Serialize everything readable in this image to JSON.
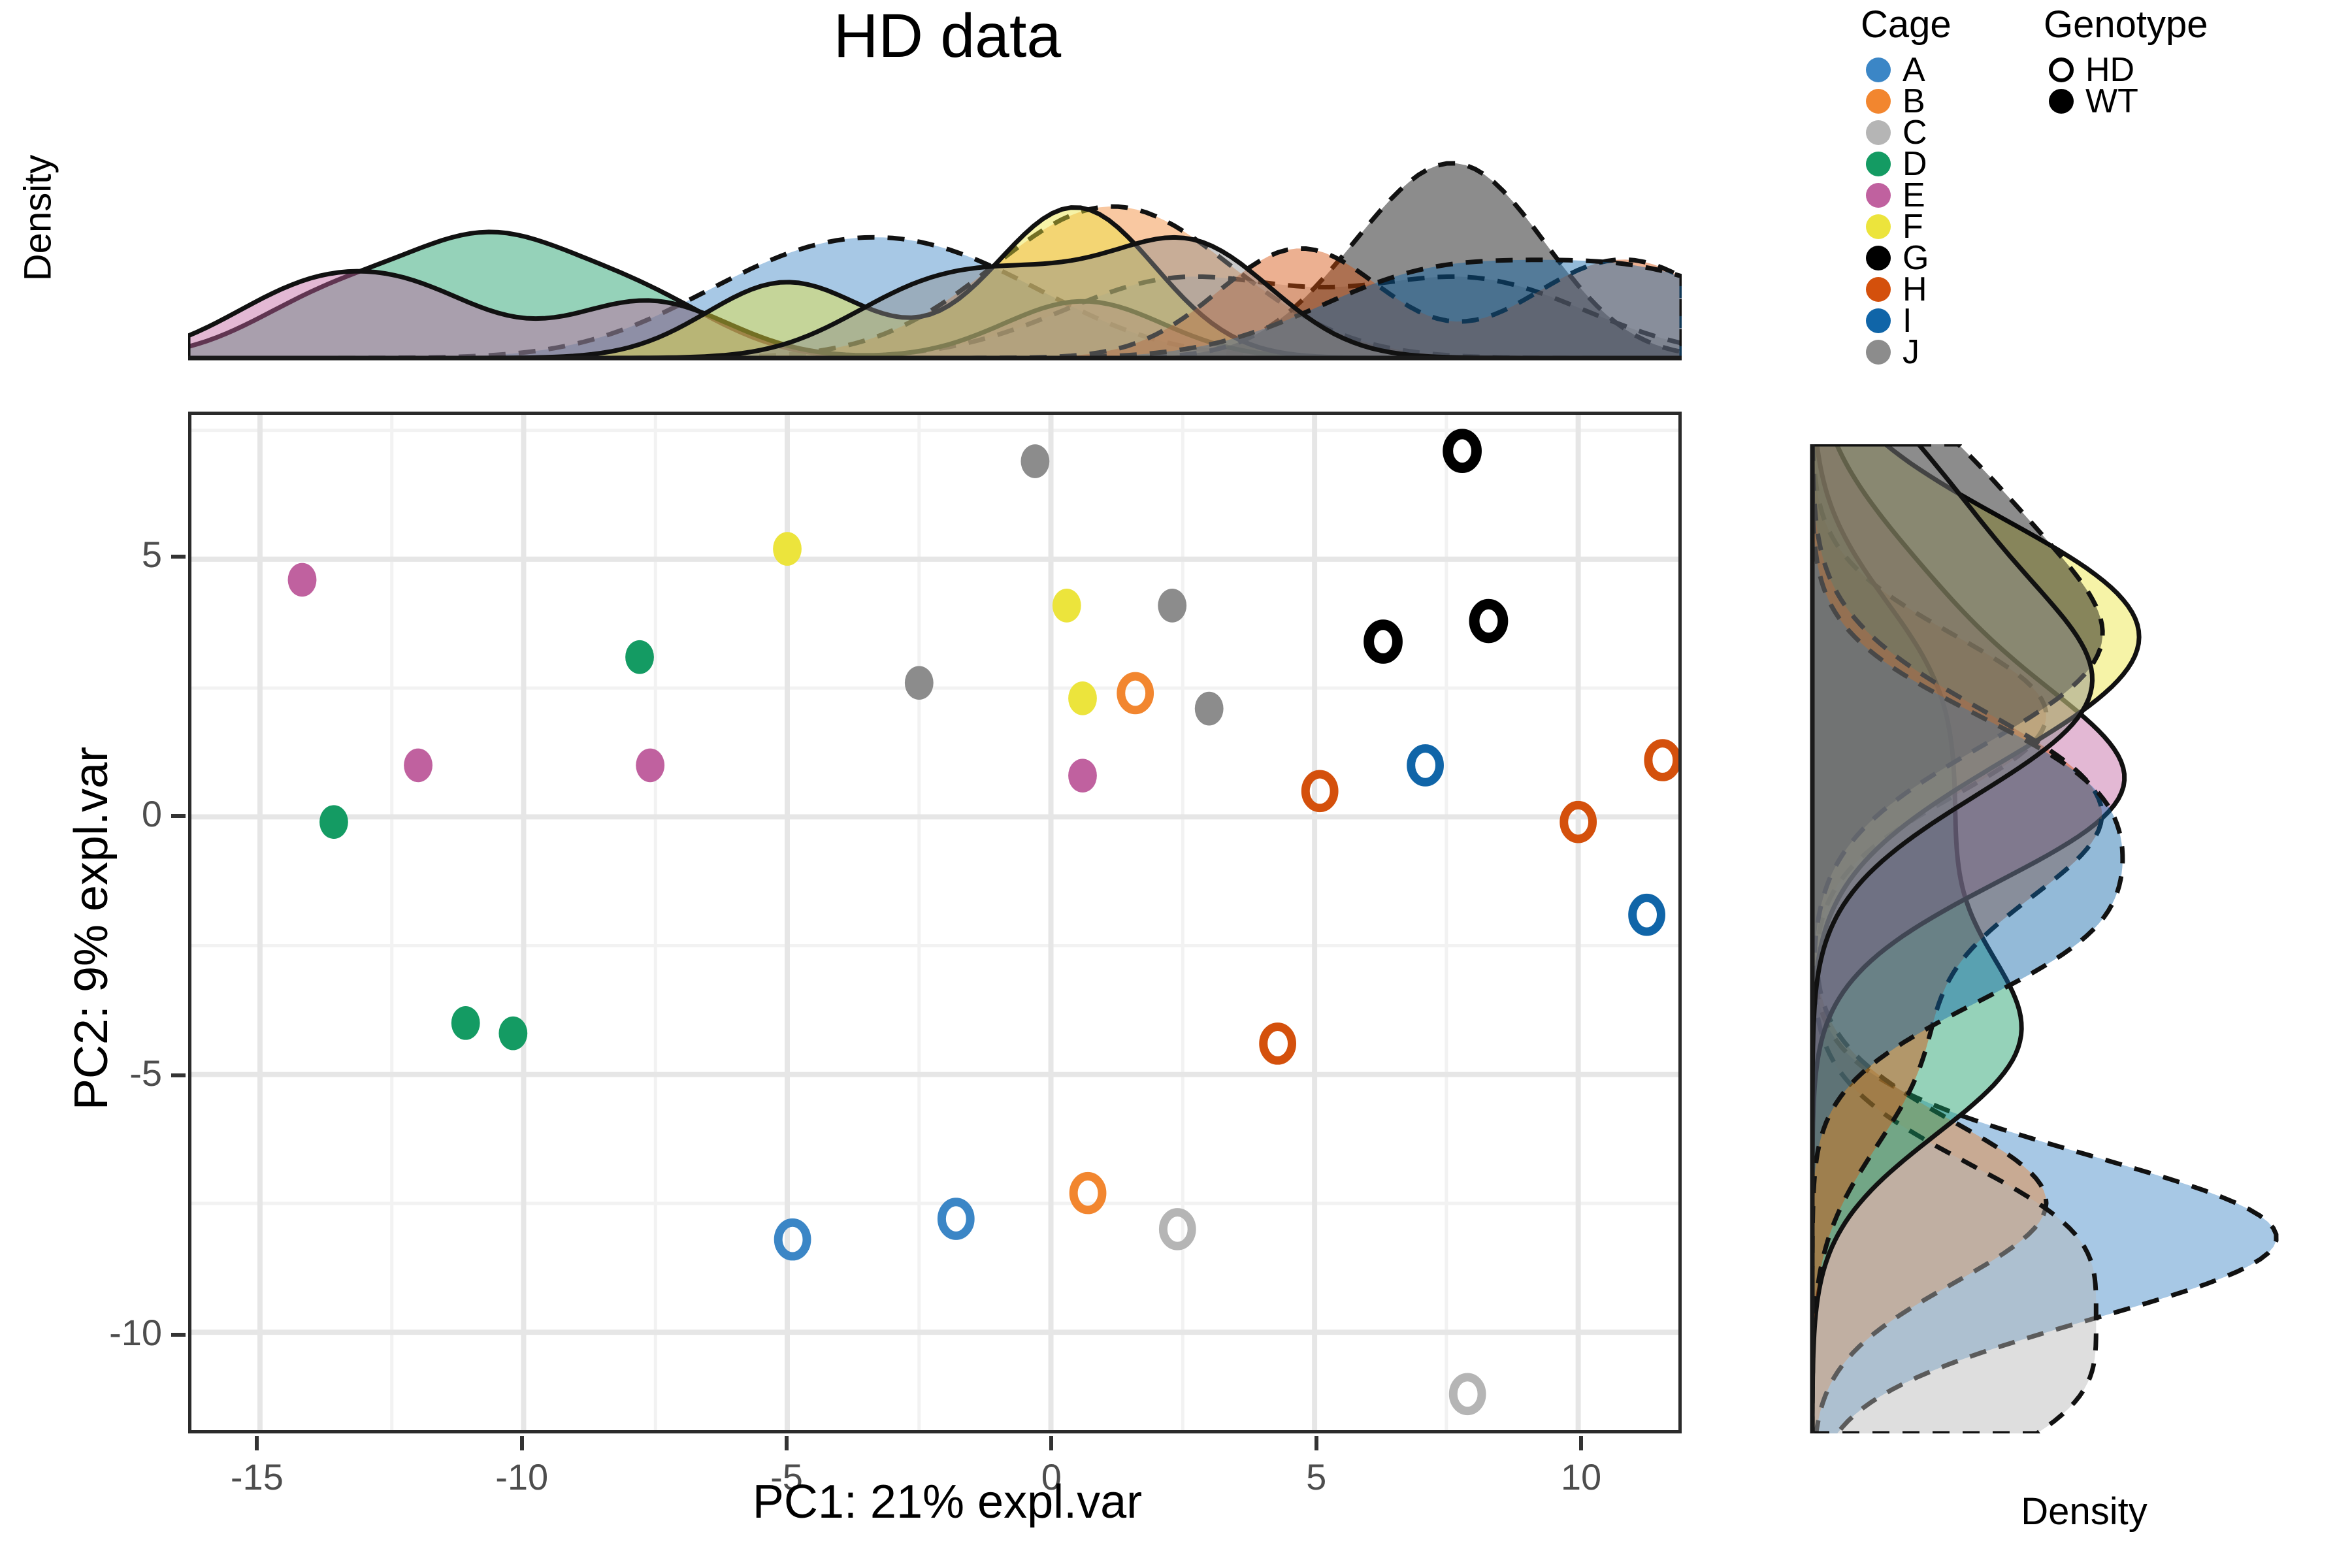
{
  "title": "HD data",
  "axes": {
    "x_title": "PC1: 21% expl.var",
    "y_title": "PC2: 9% expl.var",
    "x_ticks": [
      "-15",
      "-10",
      "-5",
      "0",
      "5",
      "10"
    ],
    "y_ticks": [
      "5",
      "0",
      "-5",
      "-10"
    ],
    "density_axis_label_top": "Density",
    "density_axis_label_right": "Density"
  },
  "legend_cage": {
    "title": "Cage",
    "items": [
      {
        "label": "A",
        "color": "#3b86c6"
      },
      {
        "label": "B",
        "color": "#f2862f"
      },
      {
        "label": "C",
        "color": "#b5b5b5"
      },
      {
        "label": "D",
        "color": "#149b63"
      },
      {
        "label": "E",
        "color": "#c0619f"
      },
      {
        "label": "F",
        "color": "#ece43c"
      },
      {
        "label": "G",
        "color": "#000000"
      },
      {
        "label": "H",
        "color": "#d4500c"
      },
      {
        "label": "I",
        "color": "#1065a8"
      },
      {
        "label": "J",
        "color": "#8c8c8c"
      }
    ]
  },
  "legend_genotype": {
    "title": "Genotype",
    "items": [
      {
        "label": "HD",
        "shape": "open-circle"
      },
      {
        "label": "WT",
        "shape": "filled-circle"
      }
    ]
  },
  "chart_data": {
    "type": "scatter",
    "title": "HD data",
    "xlabel": "PC1: 21% expl.var",
    "ylabel": "PC2: 9% expl.var",
    "xlim": [
      -16.3,
      11.9
    ],
    "ylim": [
      -11.9,
      7.8
    ],
    "xticks": [
      -15,
      -10,
      -5,
      0,
      5,
      10
    ],
    "yticks": [
      5,
      0,
      -5,
      -10
    ],
    "grid": true,
    "legend_position": "right",
    "groups": {
      "color_by": "Cage",
      "shape_by": "Genotype"
    },
    "points": [
      {
        "x": -14.2,
        "y": 4.6,
        "cage": "E",
        "genotype": "WT"
      },
      {
        "x": -13.6,
        "y": -0.1,
        "cage": "D",
        "genotype": "WT"
      },
      {
        "x": -12.0,
        "y": 1.0,
        "cage": "E",
        "genotype": "WT"
      },
      {
        "x": -11.1,
        "y": -4.0,
        "cage": "D",
        "genotype": "WT"
      },
      {
        "x": -10.2,
        "y": -4.2,
        "cage": "D",
        "genotype": "WT"
      },
      {
        "x": -7.8,
        "y": 3.1,
        "cage": "D",
        "genotype": "WT"
      },
      {
        "x": -7.6,
        "y": 1.0,
        "cage": "E",
        "genotype": "WT"
      },
      {
        "x": -5.0,
        "y": 5.2,
        "cage": "F",
        "genotype": "WT"
      },
      {
        "x": -4.9,
        "y": -8.2,
        "cage": "A",
        "genotype": "HD"
      },
      {
        "x": -2.5,
        "y": 2.6,
        "cage": "J",
        "genotype": "WT"
      },
      {
        "x": -1.8,
        "y": -7.8,
        "cage": "A",
        "genotype": "HD"
      },
      {
        "x": -0.3,
        "y": 6.9,
        "cage": "J",
        "genotype": "WT"
      },
      {
        "x": 0.3,
        "y": 4.1,
        "cage": "F",
        "genotype": "WT"
      },
      {
        "x": 0.6,
        "y": 2.3,
        "cage": "F",
        "genotype": "WT"
      },
      {
        "x": 0.6,
        "y": 0.8,
        "cage": "E",
        "genotype": "WT"
      },
      {
        "x": 0.7,
        "y": -7.3,
        "cage": "B",
        "genotype": "HD"
      },
      {
        "x": 1.6,
        "y": 2.4,
        "cage": "B",
        "genotype": "HD"
      },
      {
        "x": 2.3,
        "y": 4.1,
        "cage": "J",
        "genotype": "WT"
      },
      {
        "x": 2.4,
        "y": -8.0,
        "cage": "C",
        "genotype": "HD"
      },
      {
        "x": 3.0,
        "y": 2.1,
        "cage": "J",
        "genotype": "WT"
      },
      {
        "x": 4.3,
        "y": -4.4,
        "cage": "H",
        "genotype": "HD"
      },
      {
        "x": 5.1,
        "y": 0.5,
        "cage": "H",
        "genotype": "HD"
      },
      {
        "x": 6.3,
        "y": 3.4,
        "cage": "G",
        "genotype": "HD"
      },
      {
        "x": 7.1,
        "y": 1.0,
        "cage": "I",
        "genotype": "HD"
      },
      {
        "x": 7.8,
        "y": 7.1,
        "cage": "G",
        "genotype": "HD"
      },
      {
        "x": 7.9,
        "y": -11.2,
        "cage": "C",
        "genotype": "HD"
      },
      {
        "x": 8.3,
        "y": 3.8,
        "cage": "G",
        "genotype": "HD"
      },
      {
        "x": 10.0,
        "y": -0.1,
        "cage": "H",
        "genotype": "HD"
      },
      {
        "x": 11.3,
        "y": -1.9,
        "cage": "I",
        "genotype": "HD"
      },
      {
        "x": 11.6,
        "y": 1.1,
        "cage": "H",
        "genotype": "HD"
      }
    ],
    "marginal_densities": {
      "top": {
        "variable": "PC1",
        "note": "overlaid per-cage kernel densities; dashed outline = HD, solid outline = WT"
      },
      "right": {
        "variable": "PC2",
        "note": "overlaid per-cage kernel densities; dashed outline = HD, solid outline = WT"
      }
    }
  }
}
